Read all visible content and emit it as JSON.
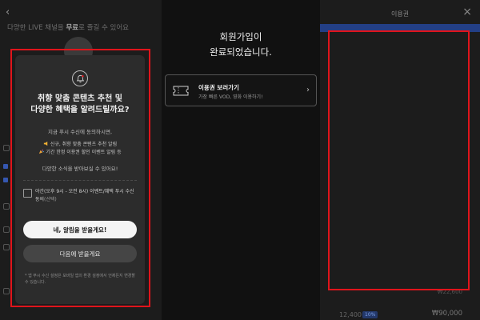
{
  "left_bg": {
    "back_glyph": "‹",
    "banner_pre": "다양한 LIVE 채널을 ",
    "banner_bold": "무료",
    "banner_post": "로 즐길 수 있어요"
  },
  "right_bg": {
    "title": "이용권",
    "close_glyph": "×",
    "row_label": "12,400",
    "row_badge": "10%",
    "row_price": "₩90,000",
    "row_price_old": "₩22,600"
  },
  "modal": {
    "title_line1": "취향 맞춤 콘텐츠 추천 및",
    "title_line2": "다양한 혜택을 알려드릴까요?",
    "desc": "지금 푸시 수신에 동의하시면,",
    "benefit1": "신규, 취향 맞춤 콘텐츠 추천 알림",
    "benefit2": "기간 한정 이용권 할인 이벤트 알림 등",
    "note": "다양한 소식을 받아보실 수 있어요!",
    "consent_text": "야간(오후 9시 - 오전 8시) 이벤트/혜택 푸시 수신 동의",
    "consent_optional": "(선택)",
    "primary_button": "네, 알림을 받을게요!",
    "secondary_button": "다음에 받을게요",
    "footnote": "* 앱 푸시 수신 설정은 모바일 앱의 환경 설정에서 언제든지 변경할 수 있습니다.",
    "checkbox_checked": false
  },
  "middle": {
    "title_line1": "회원가입이",
    "title_line2": "완료되었습니다.",
    "voucher_title": "이용권 보러가기",
    "voucher_sub": "가장 빠른 VOD, 영화 이용하기!",
    "chevron": "›"
  },
  "colors": {
    "highlight": "#e0141b",
    "accent_blue": "#233f86"
  },
  "icons": {
    "bell": "bell-icon",
    "ticket": "ticket-icon",
    "chevron": "chevron-right-icon"
  }
}
